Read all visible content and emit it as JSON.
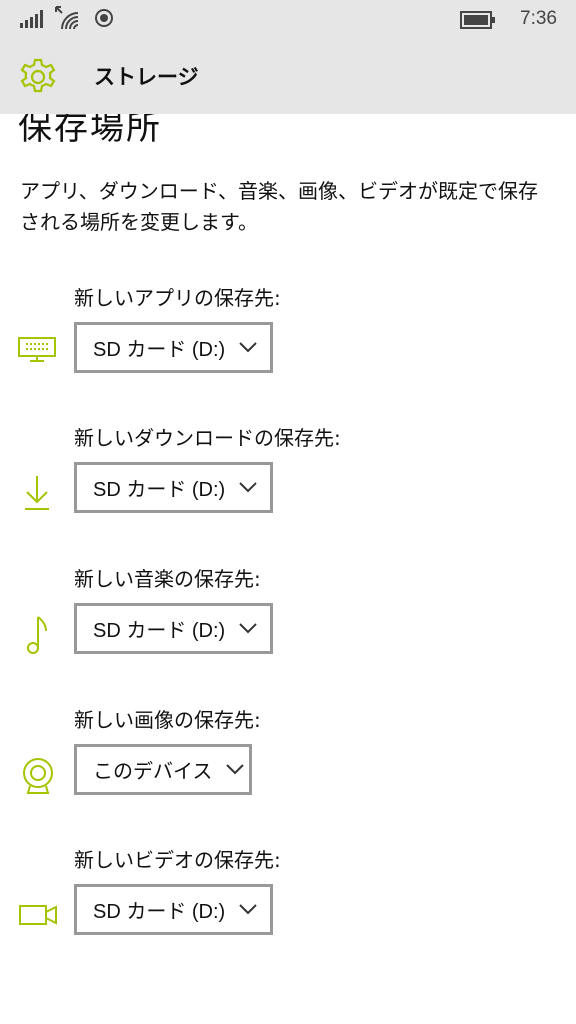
{
  "status": {
    "time": "7:36"
  },
  "header": {
    "title": "ストレージ"
  },
  "section": {
    "title": "保存場所",
    "description": "アプリ、ダウンロード、音楽、画像、ビデオが既定で保存される場所を変更します。"
  },
  "locations": [
    {
      "label": "新しいアプリの保存先:",
      "value": "SD カード (D:)",
      "icon": "monitor-icon"
    },
    {
      "label": "新しいダウンロードの保存先:",
      "value": "SD カード (D:)",
      "icon": "download-icon"
    },
    {
      "label": "新しい音楽の保存先:",
      "value": "SD カード (D:)",
      "icon": "music-note-icon"
    },
    {
      "label": "新しい画像の保存先:",
      "value": "このデバイス",
      "icon": "webcam-icon"
    },
    {
      "label": "新しいビデオの保存先:",
      "value": "SD カード (D:)",
      "icon": "video-camera-icon"
    }
  ],
  "colors": {
    "accent": "#a4c400",
    "dropdown_border": "#999999",
    "bar_bg": "#e6e6e6"
  }
}
